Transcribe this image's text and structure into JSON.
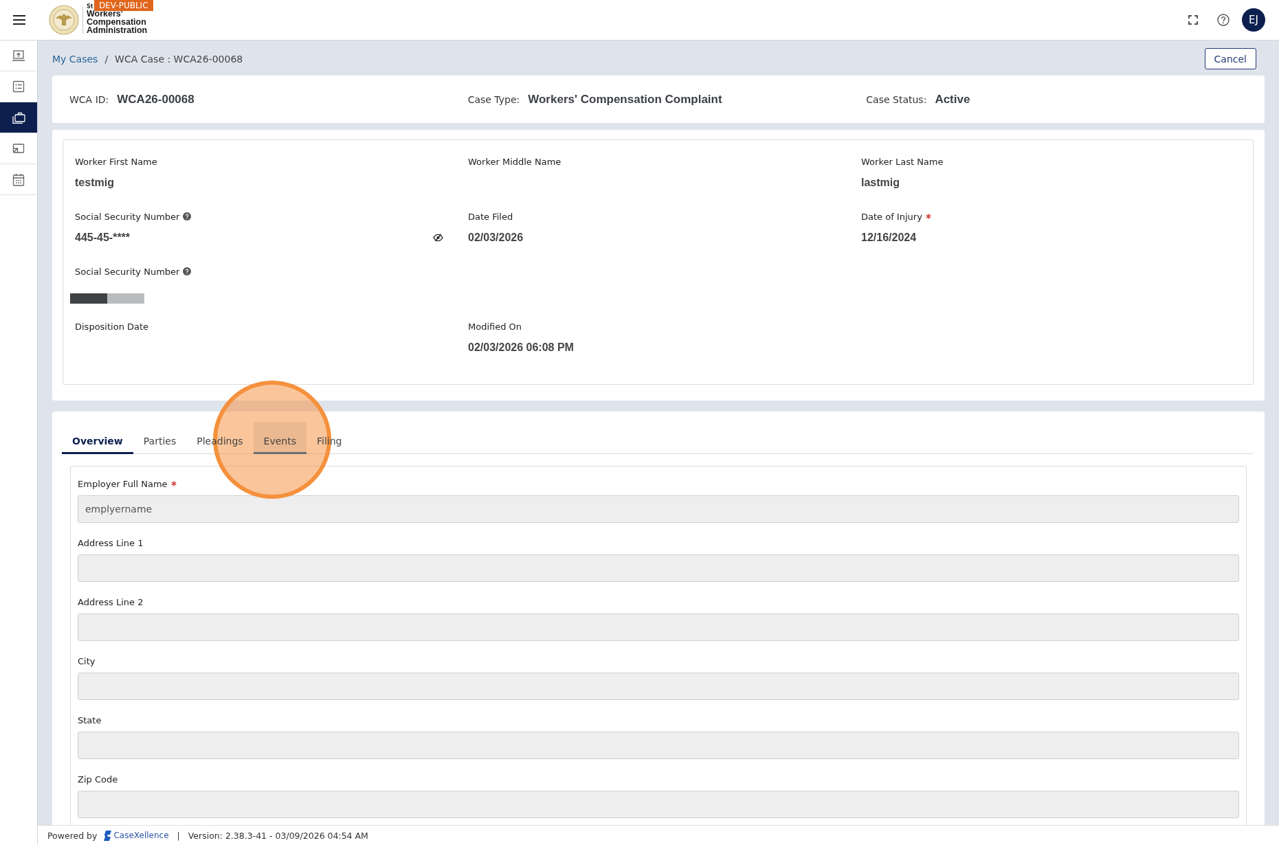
{
  "header": {
    "logo_small_text": "St",
    "badge": "DEV-PUBLIC",
    "org_name": "Workers' Compensation Administration",
    "avatar_initials": "EJ"
  },
  "sidebar": {
    "items": [
      {
        "selected": false
      },
      {
        "selected": false
      },
      {
        "selected": true
      },
      {
        "selected": false
      },
      {
        "selected": false
      }
    ]
  },
  "breadcrumb": {
    "items": [
      "My Cases",
      "WCA Case : WCA26-00068"
    ],
    "separator": "/"
  },
  "cancel_button": "Cancel",
  "case_summary": [
    {
      "label": "WCA ID:",
      "value": "WCA26-00068"
    },
    {
      "label": "Case Type:",
      "value": "Workers' Compensation Complaint"
    },
    {
      "label": "Case Status:",
      "value": "Active"
    }
  ],
  "details": {
    "rows": [
      [
        {
          "kind": "text",
          "label": "Worker First Name",
          "value": "testmig",
          "help": false,
          "required": false,
          "masked": false
        },
        {
          "kind": "text",
          "label": "Worker Middle Name",
          "help": false,
          "required": false,
          "masked": false
        },
        {
          "kind": "text",
          "label": "Worker Last Name",
          "value": "lastmig",
          "help": false,
          "required": false,
          "masked": false
        }
      ],
      [
        {
          "kind": "text",
          "label": "Social Security Number",
          "value": "445-45-****",
          "help": true,
          "required": false,
          "masked": true
        },
        {
          "kind": "text",
          "label": "Date Filed",
          "value": "02/03/2026",
          "help": false,
          "required": false,
          "masked": false
        },
        {
          "kind": "text",
          "label": "Date of Injury",
          "value": "12/16/2024",
          "help": false,
          "required": true,
          "masked": false
        }
      ],
      [
        {
          "kind": "meter",
          "label": "Social Security Number",
          "level": 0.5,
          "help": true,
          "required": false,
          "masked": false
        }
      ],
      [
        {
          "kind": "text",
          "label": "Disposition Date",
          "help": false,
          "required": false,
          "masked": false
        },
        {
          "kind": "text",
          "label": "Modified On",
          "value": "02/03/2026 06:08 PM",
          "help": false,
          "required": false,
          "masked": false
        }
      ]
    ]
  },
  "tabs": [
    {
      "label": "Overview",
      "selected": true,
      "hovered": false,
      "clicked": false
    },
    {
      "label": "Parties",
      "selected": false,
      "hovered": false,
      "clicked": false
    },
    {
      "label": "Pleadings",
      "selected": false,
      "hovered": false,
      "clicked": false
    },
    {
      "label": "Events",
      "selected": false,
      "hovered": true,
      "clicked": true
    },
    {
      "label": "Filing",
      "selected": false,
      "hovered": false,
      "clicked": false
    }
  ],
  "overview_form": [
    {
      "label": "Employer Full Name",
      "required": true,
      "disabled": true,
      "value": "emplyername"
    },
    {
      "label": "Address Line 1",
      "required": false,
      "disabled": true
    },
    {
      "label": "Address Line 2",
      "required": false,
      "disabled": true
    },
    {
      "label": "City",
      "required": false,
      "disabled": true
    },
    {
      "label": "State",
      "required": false,
      "disabled": true
    },
    {
      "label": "Zip Code",
      "required": false,
      "disabled": true
    }
  ],
  "footer": {
    "powered_by": "Powered by",
    "brand": "CaseXellence",
    "separator": "|",
    "version": "Version: 2.38.3-41 - 03/09/2026 04:54 AM"
  }
}
